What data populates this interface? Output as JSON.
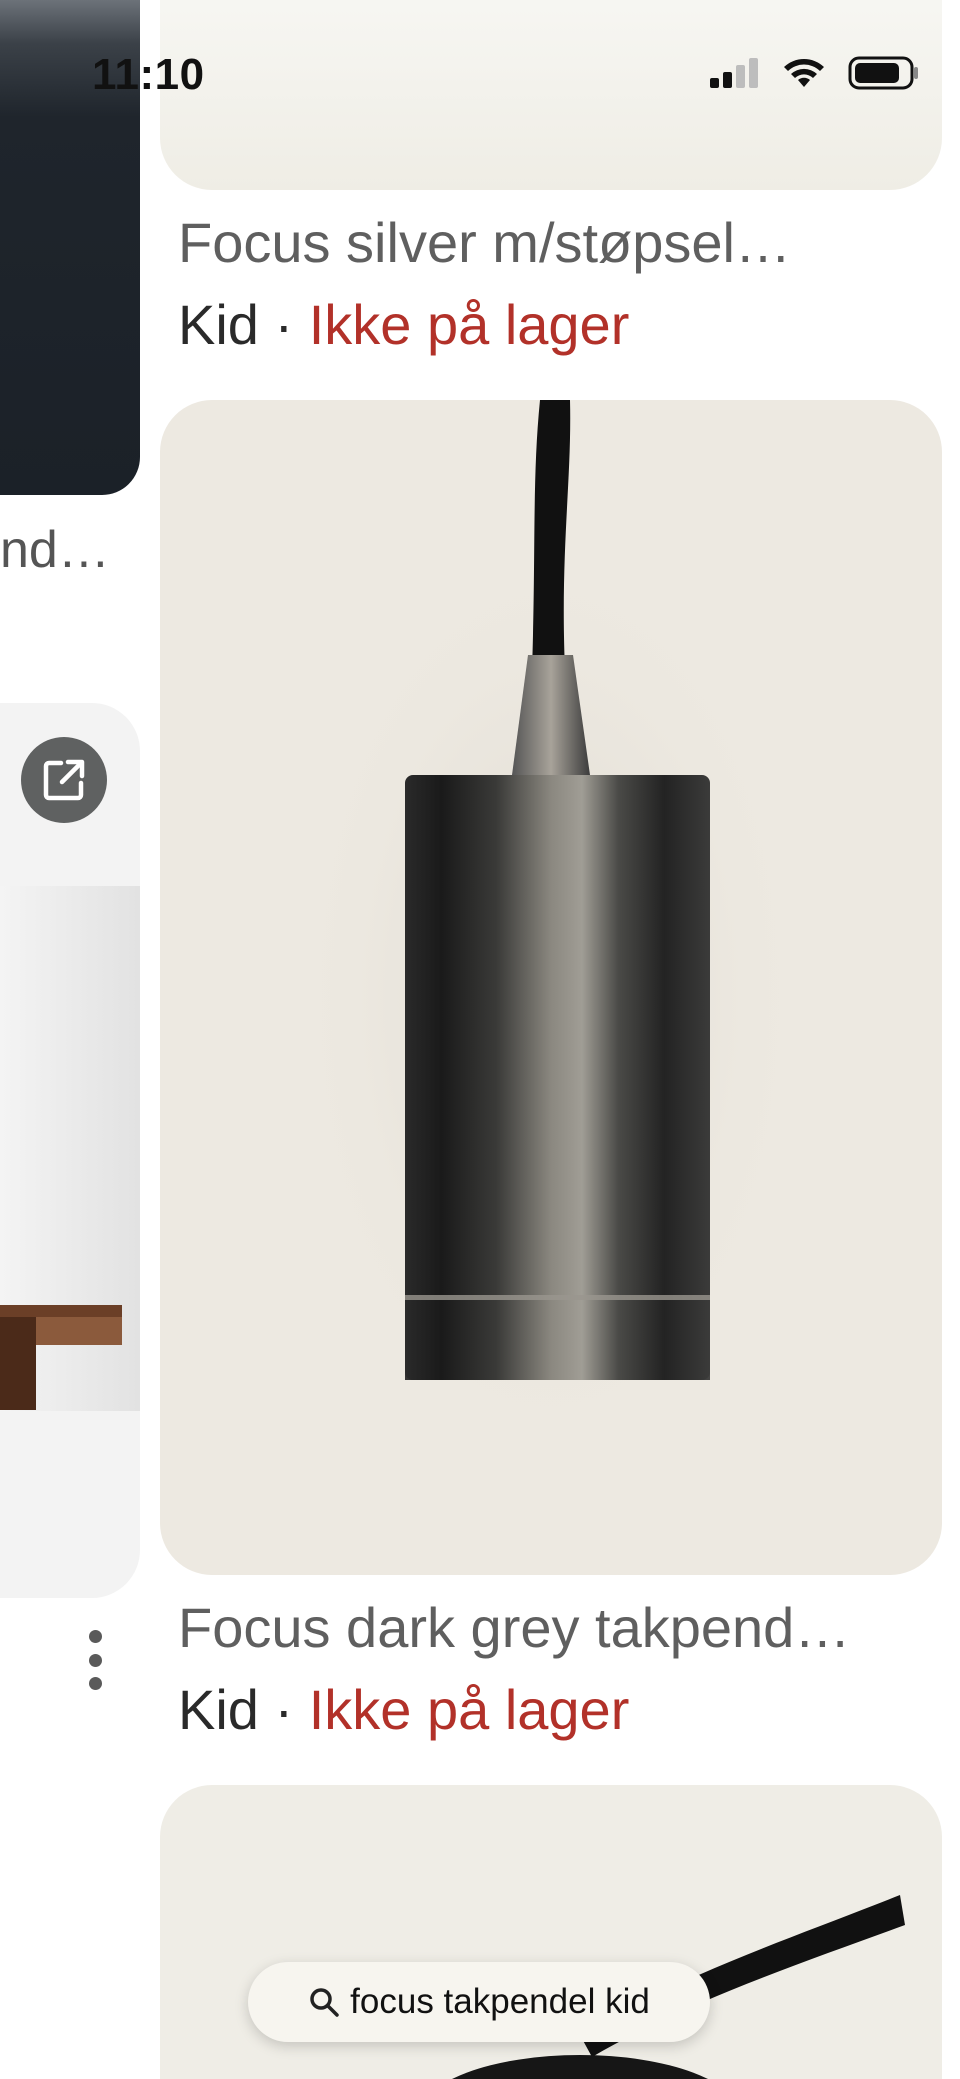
{
  "status_bar": {
    "time": "11:10",
    "icons": [
      "signal-icon",
      "wifi-icon",
      "battery-icon"
    ]
  },
  "left_column": {
    "partial_title": "nd…"
  },
  "results": [
    {
      "title": "Focus silver m/støpsel…",
      "store": "Kid",
      "separator": "·",
      "stock": "Ikke på lager"
    },
    {
      "title": "Focus dark grey takpend…",
      "store": "Kid",
      "separator": "·",
      "stock": "Ikke på lager"
    }
  ],
  "search": {
    "query": "focus takpendel kid"
  },
  "colors": {
    "out_of_stock": "#b23129",
    "card_bg": "#ede9e1"
  }
}
